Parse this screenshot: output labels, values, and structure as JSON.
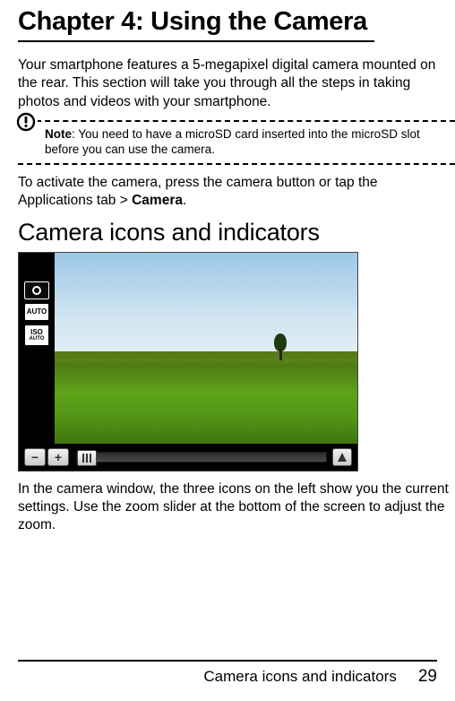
{
  "chapter": {
    "title": "Chapter 4: Using the Camera"
  },
  "intro": "Your smartphone features a 5-megapixel digital camera mounted on the rear. This section will take you through all the steps in taking photos and videos with your smartphone.",
  "note": {
    "label": "Note",
    "text": ": You need to have a microSD card inserted into the microSD slot before you can use the camera."
  },
  "activate": {
    "pre": "To activate the camera, press the camera button or tap the Applications tab > ",
    "bold": "Camera",
    "post": "."
  },
  "section": {
    "heading": "Camera icons and indicators"
  },
  "camera_ui": {
    "left_icons": {
      "camera": "camera",
      "auto": "AUTO",
      "iso_top": "ISO",
      "iso_bottom": "AUTO"
    },
    "zoom": {
      "minus": "−",
      "plus": "+"
    }
  },
  "caption": "In the camera window, the three icons on the left show you the current settings. Use the zoom slider at the bottom of the screen to adjust the zoom.",
  "footer": {
    "title": "Camera icons and indicators",
    "page": "29"
  }
}
